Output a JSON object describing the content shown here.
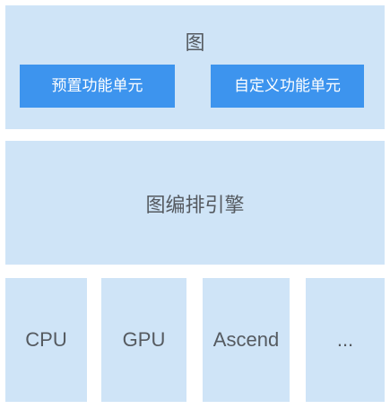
{
  "graph_layer": {
    "title": "图",
    "units": [
      {
        "label": "预置功能单元"
      },
      {
        "label": "自定义功能单元"
      }
    ]
  },
  "engine_layer": {
    "title": "图编排引擎"
  },
  "hardware_layer": {
    "items": [
      {
        "label": "CPU"
      },
      {
        "label": "GPU"
      },
      {
        "label": "Ascend"
      },
      {
        "label": "..."
      }
    ]
  },
  "colors": {
    "panel_background": "#cfe4f7",
    "unit_button": "#3d94ee",
    "text": "#555a60",
    "unit_text": "#ffffff"
  }
}
